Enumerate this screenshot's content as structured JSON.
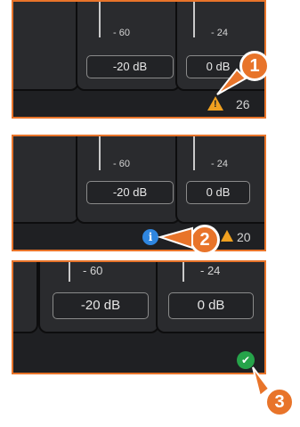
{
  "panels": [
    {
      "ticks": [
        "- 60",
        "- 24"
      ],
      "values": [
        "-20 dB",
        "0 dB"
      ],
      "status": {
        "icon": "warning-icon",
        "count": "26"
      },
      "callout": "1"
    },
    {
      "ticks": [
        "- 60",
        "- 24"
      ],
      "values": [
        "-20 dB",
        "0 dB"
      ],
      "status": {
        "icon": "info-icon",
        "count": "20",
        "info_glyph": "i"
      },
      "callout": "2"
    },
    {
      "ticks": [
        "- 60",
        "- 24"
      ],
      "values": [
        "-20 dB",
        "0 dB"
      ],
      "status": {
        "icon": "check-icon",
        "check_glyph": "✔"
      },
      "callout": "3"
    }
  ],
  "colors": {
    "accent": "#e8742a",
    "panel_bg": "#1f2023",
    "warning": "#f0a020",
    "info": "#2f86e0",
    "success": "#26a34a"
  }
}
